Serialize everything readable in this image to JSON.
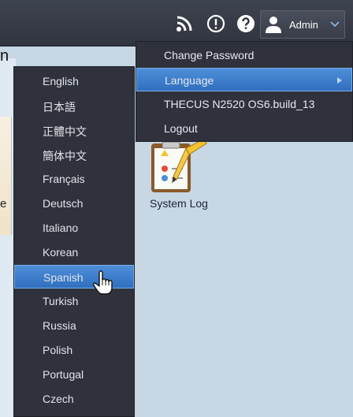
{
  "header": {
    "icons": [
      "rss-icon",
      "alert-icon",
      "help-icon"
    ],
    "user_label": "Admin"
  },
  "admin_menu": {
    "items": [
      {
        "label": "Change Password"
      },
      {
        "label": "Language",
        "active": true
      },
      {
        "label": "THECUS N2520 OS6.build_13"
      },
      {
        "label": "Logout"
      }
    ]
  },
  "language_menu": {
    "items": [
      "English",
      "日本語",
      "正體中文",
      "簡体中文",
      "Français",
      "Deutsch",
      "Italiano",
      "Korean",
      "Spanish",
      "Turkish",
      "Russia",
      "Polish",
      "Portugal",
      "Czech"
    ],
    "selected": "Spanish"
  },
  "desktop": {
    "system_log_label": "System Log",
    "partial_text_top": "n",
    "partial_text_side": "e"
  },
  "colors": {
    "menu_bg": "#2f323c",
    "highlight": "#3f7fcc",
    "desktop_bg": "#c7d7e4"
  }
}
